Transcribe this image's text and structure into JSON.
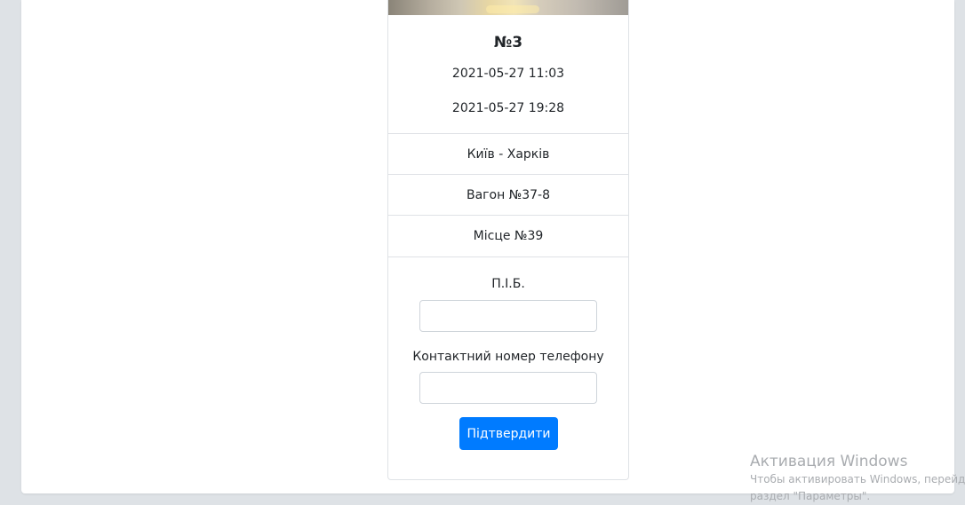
{
  "card": {
    "title": "№3",
    "departure": "2021-05-27 11:03",
    "arrival": "2021-05-27 19:28",
    "route": "Київ - Харків",
    "wagon": "Вагон №37-8",
    "seat": "Місце №39"
  },
  "form": {
    "name_label": "П.І.Б.",
    "name_value": "",
    "phone_label": "Контактний номер телефону",
    "phone_value": "",
    "submit_label": "Підтвердити"
  },
  "watermark": {
    "title": "Активация Windows",
    "line1": "Чтобы активировать Windows, перейдите в",
    "line2": "раздел \"Параметры\"."
  },
  "colors": {
    "page_background": "#dee2e6",
    "panel_background": "#ffffff",
    "border": "#dfe2e6",
    "primary": "#007bff",
    "text": "#212529",
    "watermark": "#a9acb0"
  }
}
